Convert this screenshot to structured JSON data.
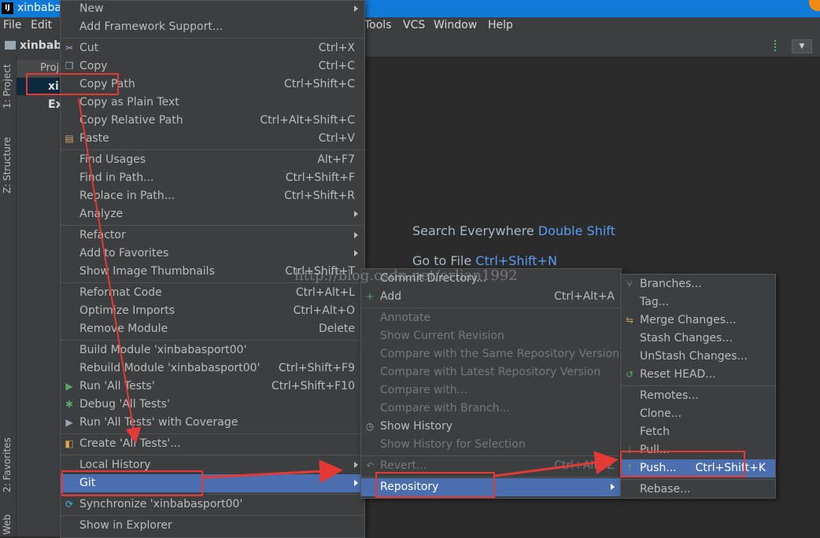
{
  "title_bar": {
    "app_icon": "IJ",
    "title": "xinbabasp"
  },
  "menu_bar": [
    {
      "label": "File"
    },
    {
      "label": "Edit"
    },
    {
      "label": "Tools"
    },
    {
      "label": "VCS"
    },
    {
      "label": "Window"
    },
    {
      "label": "Help"
    }
  ],
  "nav": {
    "project": "xinbaba"
  },
  "tool_windows": {
    "project": "1: Project",
    "structure": "Z: Structure",
    "favorites": "2: Favorites",
    "web": "Web"
  },
  "project_panel": {
    "header": "Proje",
    "rows": [
      {
        "label": "xi"
      },
      {
        "label": "Ex"
      }
    ]
  },
  "editor_hints": [
    {
      "text": "Search Everywhere",
      "key": "Double Shift"
    },
    {
      "text": "Go to File",
      "key": "Ctrl+Shift+N"
    }
  ],
  "watermark": "http://blog.csdn.net/erlian1992",
  "context_menu": {
    "items": [
      {
        "label": "New",
        "shortcut": "",
        "submenu": true
      },
      {
        "label": "Add Framework Support...",
        "shortcut": ""
      },
      {
        "label": "Cut",
        "shortcut": "Ctrl+X",
        "icon": "cut-icon"
      },
      {
        "label": "Copy",
        "shortcut": "Ctrl+C",
        "icon": "copy-icon"
      },
      {
        "label": "Copy Path",
        "shortcut": "Ctrl+Shift+C"
      },
      {
        "label": "Copy as Plain Text",
        "shortcut": ""
      },
      {
        "label": "Copy Relative Path",
        "shortcut": "Ctrl+Alt+Shift+C"
      },
      {
        "label": "Paste",
        "shortcut": "Ctrl+V",
        "icon": "paste-icon"
      },
      {
        "label": "Find Usages",
        "shortcut": "Alt+F7"
      },
      {
        "label": "Find in Path...",
        "shortcut": "Ctrl+Shift+F"
      },
      {
        "label": "Replace in Path...",
        "shortcut": "Ctrl+Shift+R"
      },
      {
        "label": "Analyze",
        "shortcut": "",
        "submenu": true
      },
      {
        "label": "Refactor",
        "shortcut": "",
        "submenu": true
      },
      {
        "label": "Add to Favorites",
        "shortcut": "",
        "submenu": true
      },
      {
        "label": "Show Image Thumbnails",
        "shortcut": "Ctrl+Shift+T"
      },
      {
        "label": "Reformat Code",
        "shortcut": "Ctrl+Alt+L"
      },
      {
        "label": "Optimize Imports",
        "shortcut": "Ctrl+Alt+O"
      },
      {
        "label": "Remove Module",
        "shortcut": "Delete"
      },
      {
        "label": "Build Module 'xinbabasport00'",
        "shortcut": ""
      },
      {
        "label": "Rebuild Module 'xinbabasport00'",
        "shortcut": "Ctrl+Shift+F9"
      },
      {
        "label": "Run 'All Tests'",
        "shortcut": "Ctrl+Shift+F10",
        "icon": "run-icon"
      },
      {
        "label": "Debug 'All Tests'",
        "shortcut": "",
        "icon": "debug-icon"
      },
      {
        "label": "Run 'All Tests' with Coverage",
        "shortcut": "",
        "icon": "coverage-icon"
      },
      {
        "label": "Create 'All Tests'...",
        "shortcut": "",
        "icon": "test-config-icon"
      },
      {
        "label": "Local History",
        "shortcut": "",
        "submenu": true
      },
      {
        "label": "Git",
        "shortcut": "",
        "submenu": true,
        "highlighted": true
      },
      {
        "label": "Synchronize 'xinbabasport00'",
        "shortcut": "",
        "icon": "sync-icon"
      },
      {
        "label": "Show in Explorer",
        "shortcut": ""
      }
    ]
  },
  "git_menu": {
    "items": [
      {
        "label": "Commit Directory...",
        "shortcut": ""
      },
      {
        "label": "Add",
        "shortcut": "Ctrl+Alt+A",
        "icon": "add-icon"
      },
      {
        "label": "Annotate",
        "shortcut": "",
        "disabled": true
      },
      {
        "label": "Show Current Revision",
        "shortcut": "",
        "disabled": true
      },
      {
        "label": "Compare with the Same Repository Version",
        "shortcut": "",
        "disabled": true
      },
      {
        "label": "Compare with Latest Repository Version",
        "shortcut": "",
        "disabled": true
      },
      {
        "label": "Compare with...",
        "shortcut": "",
        "disabled": true
      },
      {
        "label": "Compare with Branch...",
        "shortcut": "",
        "disabled": true
      },
      {
        "label": "Show History",
        "shortcut": "",
        "icon": "history-icon"
      },
      {
        "label": "Show History for Selection",
        "shortcut": "",
        "disabled": true
      },
      {
        "label": "Revert...",
        "shortcut": "Ctrl+Alt+Z",
        "disabled": true,
        "icon": "revert-icon"
      },
      {
        "label": "Repository",
        "shortcut": "",
        "submenu": true,
        "highlighted": true
      }
    ]
  },
  "repository_menu": {
    "items": [
      {
        "label": "Branches...",
        "shortcut": "",
        "icon": "branch-icon"
      },
      {
        "label": "Tag...",
        "shortcut": ""
      },
      {
        "label": "Merge Changes...",
        "shortcut": "",
        "icon": "merge-icon"
      },
      {
        "label": "Stash Changes...",
        "shortcut": ""
      },
      {
        "label": "UnStash Changes...",
        "shortcut": ""
      },
      {
        "label": "Reset HEAD...",
        "shortcut": "",
        "icon": "reset-icon"
      },
      {
        "label": "Remotes...",
        "shortcut": ""
      },
      {
        "label": "Clone...",
        "shortcut": ""
      },
      {
        "label": "Fetch",
        "shortcut": ""
      },
      {
        "label": "Pull...",
        "shortcut": "",
        "icon": "vcs-pull-icon"
      },
      {
        "label": "Push...",
        "shortcut": "Ctrl+Shift+K",
        "highlighted": true,
        "icon": "vcs-push-icon"
      },
      {
        "label": "Rebase...",
        "shortcut": ""
      }
    ]
  },
  "annotation_colors": {
    "box": "#e53935",
    "highlight": "#4b6eaf"
  }
}
